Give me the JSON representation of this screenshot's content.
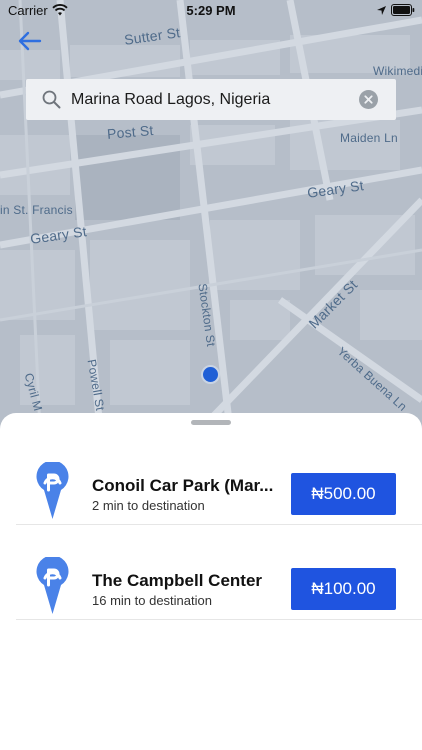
{
  "status_bar": {
    "carrier": "Carrier",
    "time": "5:29 PM",
    "icons": [
      "wifi-icon",
      "location-arrow-icon",
      "battery-icon"
    ]
  },
  "map": {
    "street_labels": {
      "sutter": "Sutter St",
      "wikimedia": "Wikimedi",
      "post": "Post St",
      "maiden": "Maiden Ln",
      "geary_right": "Geary St",
      "st_francis": "in St. Francis",
      "geary_left": "Geary St",
      "stockton": "Stockton St",
      "market": "Market St",
      "powell": "Powell St",
      "cyril": "Cyril M",
      "yerba": "Yerba Buena Ln"
    },
    "user_location_color": "#1f5fd6"
  },
  "header": {
    "back_icon": "back-arrow-icon"
  },
  "search": {
    "value": "Marina Road Lagos, Nigeria",
    "icons": [
      "search-icon",
      "clear-icon"
    ]
  },
  "results": [
    {
      "title": "Conoil Car Park (Mar...",
      "subtitle": "2 min to destination",
      "price": "₦500.00",
      "icon": "parking-pin-icon"
    },
    {
      "title": "The Campbell Center",
      "subtitle": "16 min to destination",
      "price": "₦100.00",
      "icon": "parking-pin-icon"
    }
  ],
  "colors": {
    "accent": "#1f54e0",
    "pin": "#4a82e8",
    "map_background": "#b6bec9"
  }
}
